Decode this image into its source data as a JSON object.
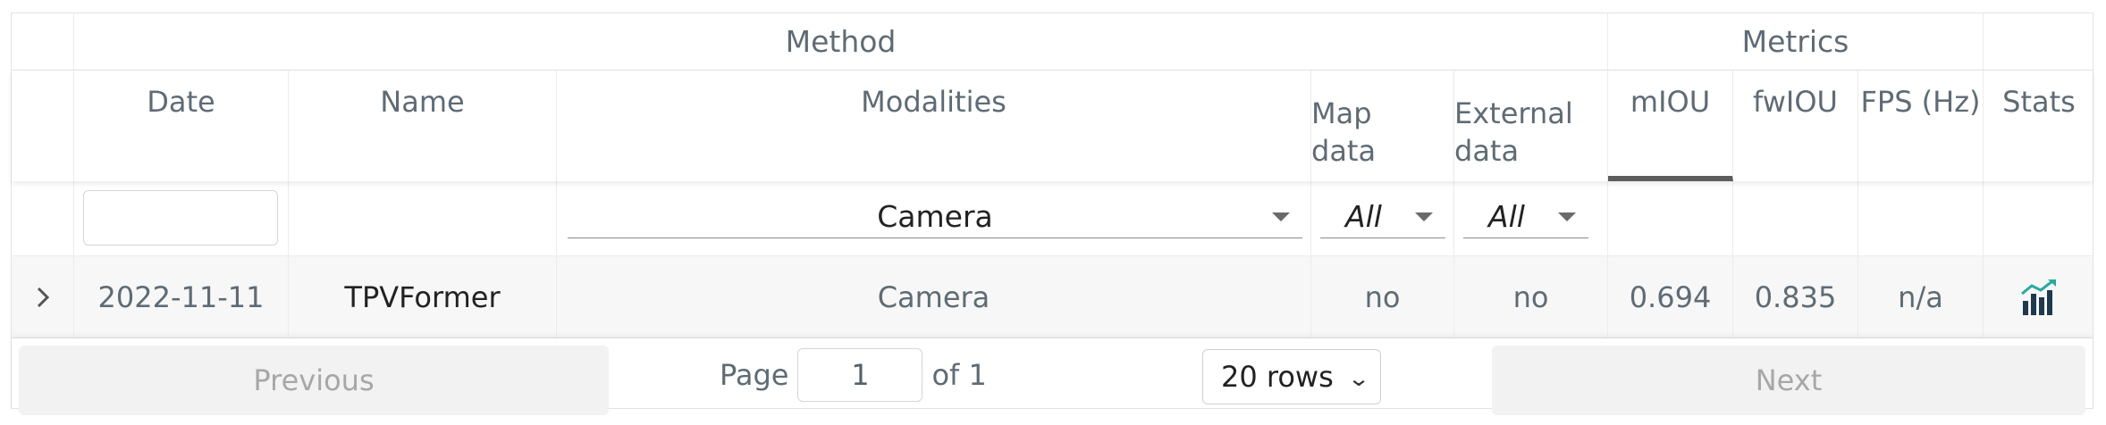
{
  "groups": {
    "method": "Method",
    "metrics": "Metrics"
  },
  "columns": {
    "date": "Date",
    "name": "Name",
    "modalities": "Modalities",
    "map_data_line1": "Map",
    "map_data_line2": "data",
    "external_line1": "External",
    "external_line2": "data",
    "miou": "mIOU",
    "fwiou": "fwIOU",
    "fps": "FPS (Hz)",
    "stats": "Stats"
  },
  "filters": {
    "date_value": "",
    "modalities_value": "Camera",
    "map_data_value": "All",
    "external_value": "All"
  },
  "rows": [
    {
      "date": "2022-11-11",
      "name": "TPVFormer",
      "modalities": "Camera",
      "map_data": "no",
      "external_data": "no",
      "miou": "0.694",
      "fwiou": "0.835",
      "fps": "n/a",
      "stats_icon": "chart-up-icon"
    }
  ],
  "pagination": {
    "previous": "Previous",
    "page_label": "Page",
    "page_value": "1",
    "of_label": "of 1",
    "rows_value": "20 rows",
    "next": "Next"
  },
  "colors": {
    "stats_icon_bars": "#1e3a4c",
    "stats_icon_arrow": "#2aa9a0"
  }
}
